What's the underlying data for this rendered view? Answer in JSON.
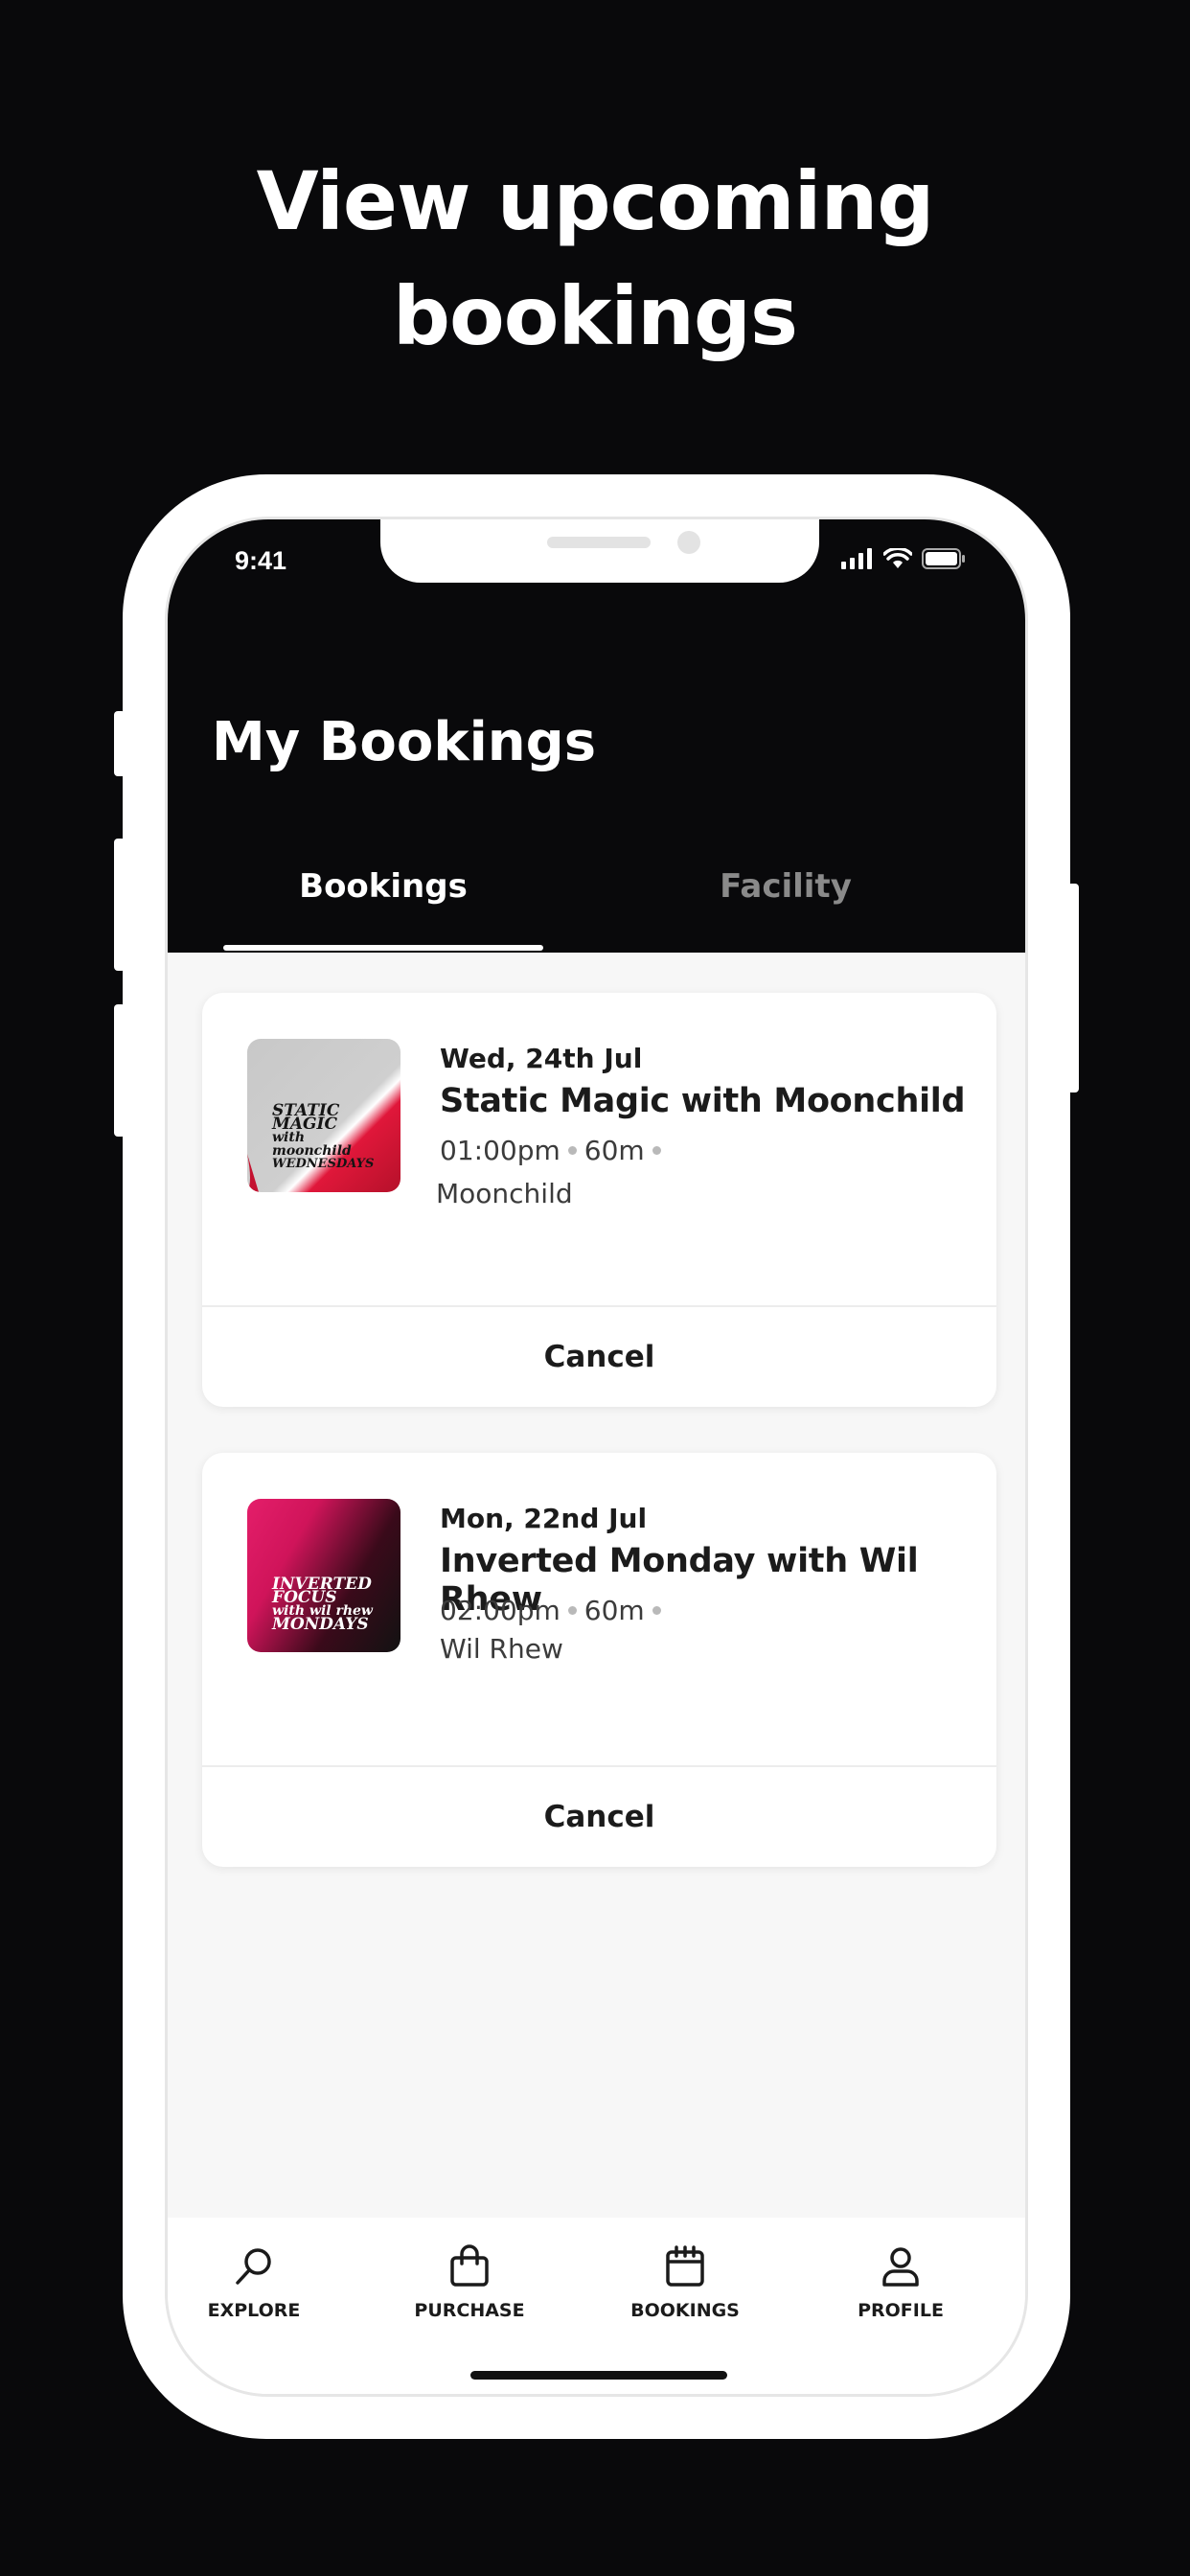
{
  "headline": {
    "line1": "View upcoming",
    "line2": "bookings"
  },
  "status_bar": {
    "time": "9:41"
  },
  "page": {
    "title": "My Bookings"
  },
  "tabs": [
    {
      "label": "Bookings",
      "active": true
    },
    {
      "label": "Facility",
      "active": false
    }
  ],
  "bookings": [
    {
      "date": "Wed, 24th  Jul",
      "title": "Static Magic with Moonchild",
      "time": "01:00pm",
      "duration": "60m",
      "host": "Moonchild",
      "thumbnail_text": [
        "STATIC",
        "MAGIC",
        "with",
        "moonchild",
        "WEDNESDAYS"
      ],
      "action": "Cancel"
    },
    {
      "date": "Mon, 22nd  Jul",
      "title": "Inverted Monday with Wil Rhew",
      "time": "02:00pm",
      "duration": "60m",
      "host": "Wil Rhew",
      "thumbnail_text": [
        "INVERTED",
        "FOCUS",
        "with wil rhew",
        "MONDAYS"
      ],
      "action": "Cancel"
    }
  ],
  "bottom_nav": [
    {
      "label": "EXPLORE",
      "icon": "search-icon"
    },
    {
      "label": "PURCHASE",
      "icon": "bag-icon"
    },
    {
      "label": "BOOKINGS",
      "icon": "calendar-icon"
    },
    {
      "label": "PROFILE",
      "icon": "user-icon"
    }
  ],
  "colors": {
    "background": "#09090b",
    "screen_bg": "#f7f7f7",
    "text": "#1b1b1b",
    "tab_inactive": "#8a8a8a",
    "accent_red": "#e0173a",
    "accent_pink": "#e41e6a"
  }
}
